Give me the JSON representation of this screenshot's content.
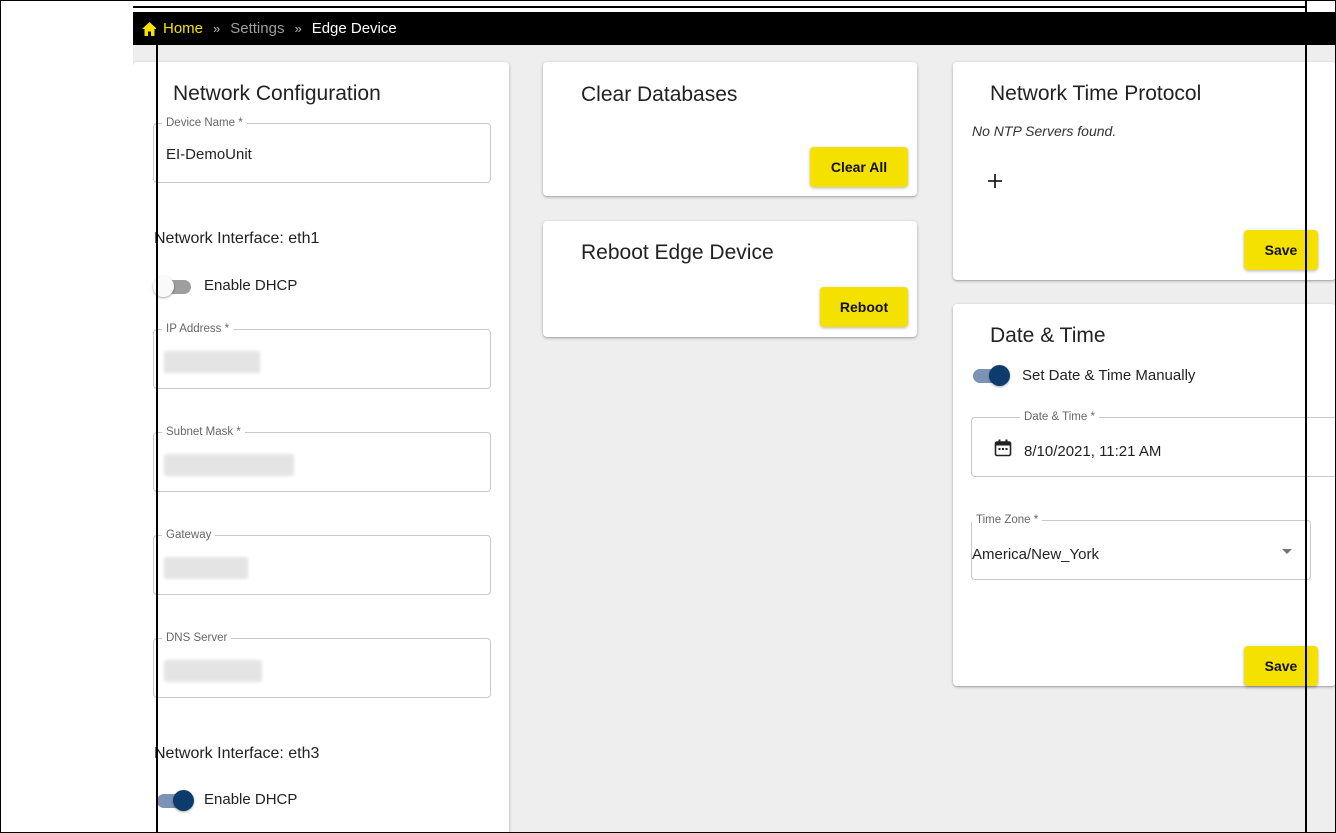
{
  "breadcrumb": {
    "home_icon": "home-icon",
    "home": "Home",
    "separator": "»",
    "settings": "Settings",
    "current": "Edge Device"
  },
  "network_config": {
    "title": "Network Configuration",
    "device_name": {
      "label": "Device Name *",
      "value": "EI-DemoUnit"
    },
    "interface1": {
      "label": "Network Interface: eth1",
      "dhcp_label": "Enable DHCP",
      "dhcp_enabled": false,
      "fields": [
        {
          "label": "IP Address *"
        },
        {
          "label": "Subnet Mask *"
        },
        {
          "label": "Gateway"
        },
        {
          "label": "DNS Server"
        }
      ]
    },
    "interface2": {
      "label": "Network Interface: eth3",
      "dhcp_label": "Enable DHCP",
      "dhcp_enabled": true
    }
  },
  "clear_databases": {
    "title": "Clear Databases",
    "button": "Clear All"
  },
  "reboot": {
    "title": "Reboot Edge Device",
    "button": "Reboot"
  },
  "ntp": {
    "title": "Network Time Protocol",
    "empty_message": "No NTP Servers found.",
    "add_icon": "plus-icon",
    "save": "Save"
  },
  "date_time": {
    "title": "Date & Time",
    "manual_label": "Set Date & Time Manually",
    "manual_enabled": true,
    "datetime": {
      "label": "Date & Time *",
      "value": "8/10/2021, 11:21 AM",
      "icon": "calendar-icon"
    },
    "timezone": {
      "label": "Time Zone *",
      "value": "America/New_York"
    },
    "save": "Save"
  },
  "colors": {
    "accent_yellow": "#f5e100",
    "switch_on": "#0d3b6e",
    "topbar": "#000000",
    "background": "#eeeeee"
  }
}
